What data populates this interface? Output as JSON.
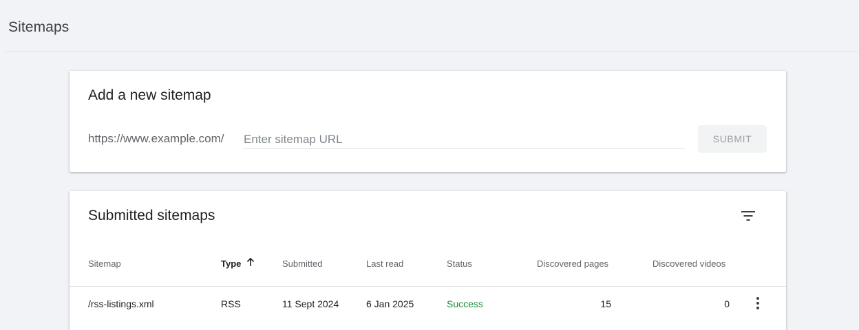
{
  "page": {
    "title": "Sitemaps"
  },
  "add_card": {
    "title": "Add a new sitemap",
    "url_prefix": "https://www.example.com/",
    "input_placeholder": "Enter sitemap URL",
    "input_value": "",
    "submit_label": "SUBMIT"
  },
  "submitted_card": {
    "title": "Submitted sitemaps",
    "filter_icon": "filter-list-icon",
    "columns": [
      "Sitemap",
      "Type",
      "Submitted",
      "Last read",
      "Status",
      "Discovered pages",
      "Discovered videos"
    ],
    "sorted_column": "Type",
    "sort_direction": "ascending",
    "rows": [
      {
        "sitemap": "/rss-listings.xml",
        "type": "RSS",
        "submitted": "11 Sept 2024",
        "last_read": "6 Jan 2025",
        "status": "Success",
        "discovered_pages": "15",
        "discovered_videos": "0",
        "more_icon": "more-vert-icon"
      }
    ]
  },
  "colors": {
    "background": "#f1f3f6",
    "card": "#ffffff",
    "success": "#1e8e3e",
    "muted_text": "#5f6368"
  }
}
